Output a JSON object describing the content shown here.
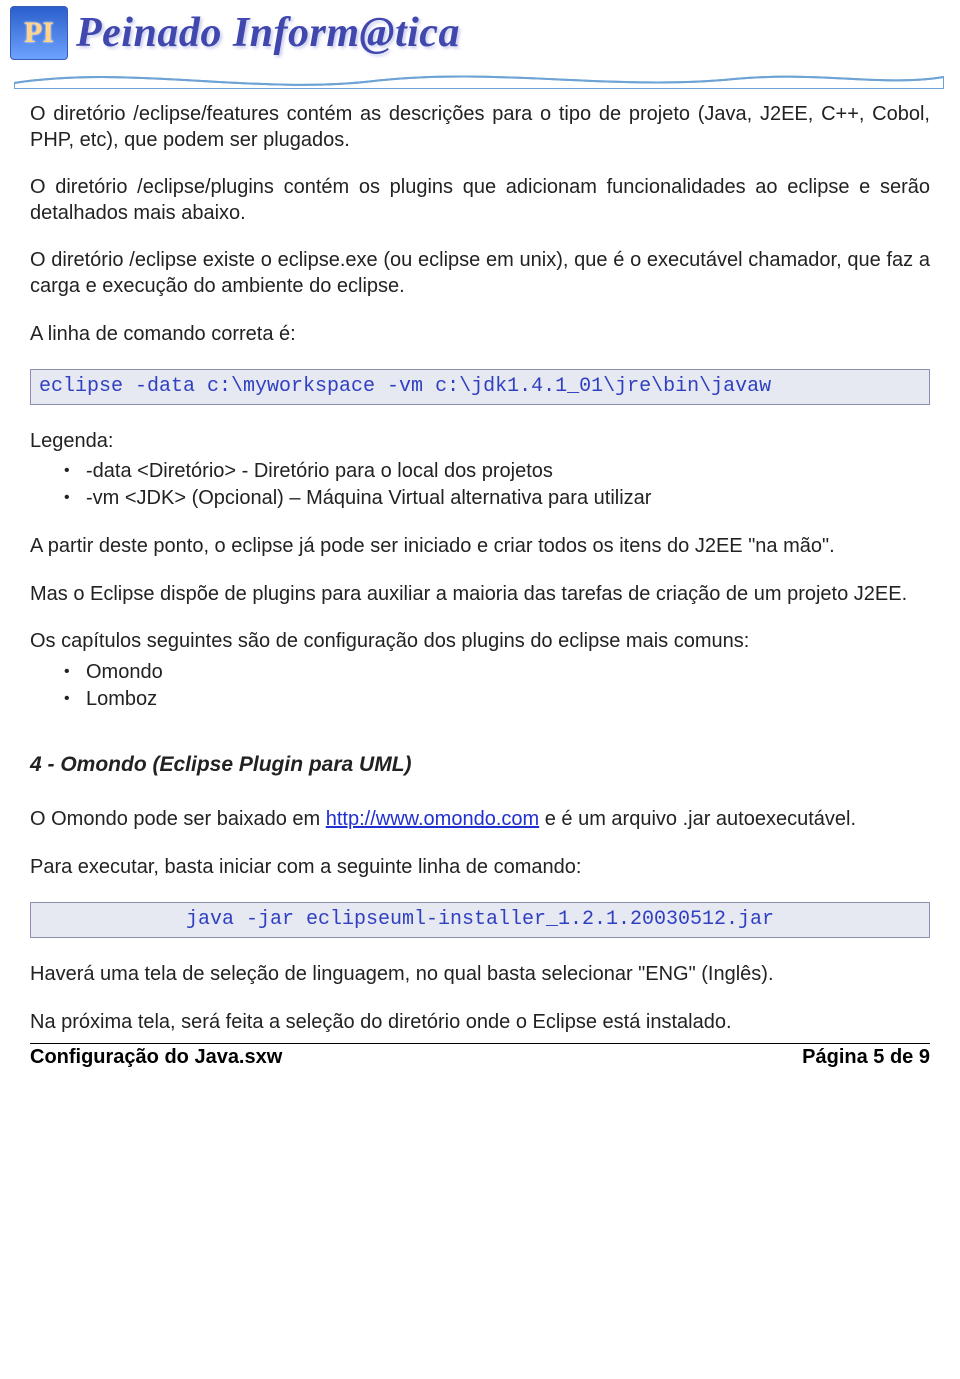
{
  "header": {
    "logo_text": "PI",
    "brand_text": "Peinado Inform@tica"
  },
  "body": {
    "p1": "O diretório /eclipse/features contém as descrições para o tipo de projeto (Java, J2EE, C++, Cobol, PHP, etc), que podem ser plugados.",
    "p2": "O diretório /eclipse/plugins contém os plugins que adicionam funcionalidades ao eclipse e serão detalhados mais abaixo.",
    "p3": "O diretório /eclipse existe o eclipse.exe (ou eclipse em unix), que é o executável chamador, que faz a carga e execução do ambiente do eclipse.",
    "p4": "A linha de comando correta é:",
    "code1": "eclipse -data c:\\myworkspace -vm c:\\jdk1.4.1_01\\jre\\bin\\javaw",
    "legenda_label": "Legenda:",
    "legenda_items": [
      "-data <Diretório> - Diretório para o local dos projetos",
      "-vm <JDK> (Opcional) – Máquina Virtual alternativa para utilizar"
    ],
    "p5": "A partir deste ponto, o eclipse já pode ser iniciado e criar todos os itens do J2EE \"na mão\".",
    "p6": "Mas o Eclipse dispõe de plugins para auxiliar a maioria das tarefas de criação de um projeto J2EE.",
    "p7": "Os capítulos seguintes são de configuração dos plugins do eclipse mais comuns:",
    "plugins": [
      "Omondo",
      "Lomboz"
    ],
    "heading4": "4 - Omondo (Eclipse Plugin para UML)",
    "p8_pre": "O Omondo pode ser baixado em ",
    "p8_link": "http://www.omondo.com",
    "p8_post": " e é um arquivo .jar autoexecutável.",
    "p9": "Para executar, basta iniciar com a seguinte linha de comando:",
    "code2": "java -jar eclipseuml-installer_1.2.1.20030512.jar",
    "p10": "Haverá uma tela de seleção de linguagem, no qual basta selecionar \"ENG\" (Inglês).",
    "p11": "Na próxima tela, será feita a seleção do diretório onde o Eclipse está instalado."
  },
  "footer": {
    "left": "Configuração do Java.sxw",
    "right": "Página 5 de 9"
  }
}
